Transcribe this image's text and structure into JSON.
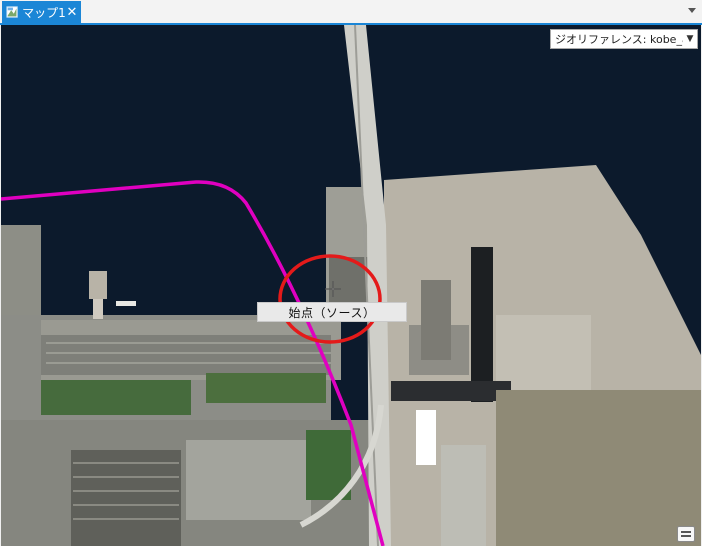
{
  "tab": {
    "label": "マップ1",
    "close": "✕",
    "icon": "map-icon"
  },
  "georeference_dropdown": {
    "value": "ジオリファレンス: kobe_ai..."
  },
  "map": {
    "tooltip": "始点（ソース）"
  },
  "icons": {
    "cursor": "crosshair-move-cursor",
    "corner_button": "table-of-contents-icon"
  },
  "colors": {
    "accent": "#1b86d6",
    "link_line": "#e000c0",
    "highlight_circle": "#e41a1a",
    "water": "#0c1a2c"
  }
}
